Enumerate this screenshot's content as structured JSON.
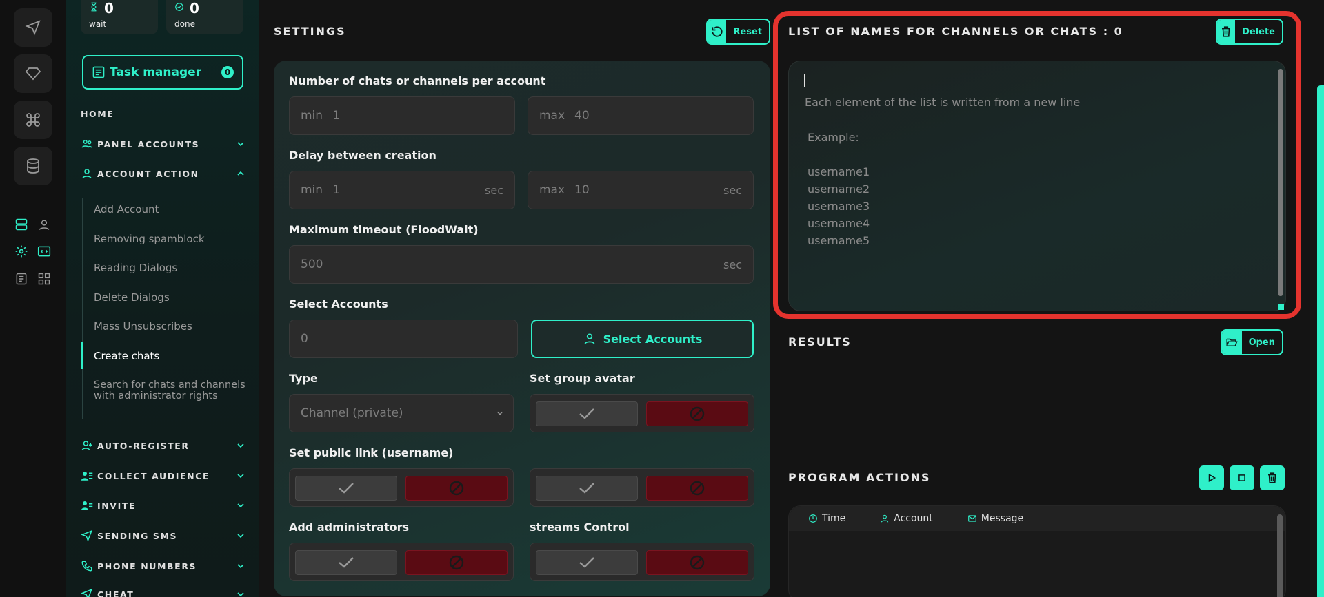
{
  "sidebar_top": {
    "wait": {
      "value": "0",
      "label": "wait"
    },
    "done": {
      "value": "0",
      "label": "done"
    }
  },
  "task_manager": {
    "label": "Task manager",
    "count": "0"
  },
  "nav": {
    "home": "HOME",
    "panel_accounts": "PANEL ACCOUNTS",
    "account_action": "ACCOUNT ACTION",
    "items": [
      "Add Account",
      "Removing spamblock",
      "Reading Dialogs",
      "Delete Dialogs",
      "Mass Unsubscribes",
      "Create chats",
      "Search for chats and channels with administrator rights"
    ],
    "active_item": "Create chats",
    "auto_register": "AUTO-REGISTER",
    "collect_audience": "COLLECT AUDIENCE",
    "invite": "INVITE",
    "sending_sms": "SENDING SMS",
    "phone_numbers": "PHONE NUMBERS",
    "cheat": "CHEAT"
  },
  "settings": {
    "title": "SETTINGS",
    "reset_label": "Reset",
    "chats_per_account": {
      "label": "Number of chats or channels per account",
      "min_prefix": "min",
      "min": "1",
      "max_prefix": "max",
      "max": "40"
    },
    "delay": {
      "label": "Delay between creation",
      "min_prefix": "min",
      "min": "1",
      "max_prefix": "max",
      "max": "10",
      "unit": "sec"
    },
    "timeout": {
      "label": "Maximum timeout (FloodWait)",
      "value": "500",
      "unit": "sec"
    },
    "select_accounts": {
      "label": "Select Accounts",
      "value": "0",
      "button": "Select Accounts"
    },
    "type": {
      "label": "Type",
      "value": "Channel (private)"
    },
    "group_avatar": {
      "label": "Set group avatar",
      "state": "off"
    },
    "public_link": {
      "label": "Set public link (username)",
      "state": "off"
    },
    "public_link_2": {
      "state": "off"
    },
    "add_admins": {
      "label": "Add administrators",
      "state": "off"
    },
    "streams_control": {
      "label": "streams Control",
      "state": "off"
    }
  },
  "names_list": {
    "title": "LIST OF NAMES FOR CHANNELS OR CHATS : 0",
    "delete_label": "Delete",
    "placeholder_lines": [
      "Each element of the list is written from a new line",
      "Example:",
      "username1",
      "username2",
      "username3",
      "username4",
      "username5"
    ]
  },
  "results": {
    "title": "RESULTS",
    "open_label": "Open"
  },
  "program_actions": {
    "title": "PROGRAM ACTIONS",
    "columns": [
      "Time",
      "Account",
      "Message"
    ]
  },
  "colors": {
    "accent": "#2ff0c9",
    "danger": "#5a0b13",
    "highlight": "#e5332e"
  }
}
